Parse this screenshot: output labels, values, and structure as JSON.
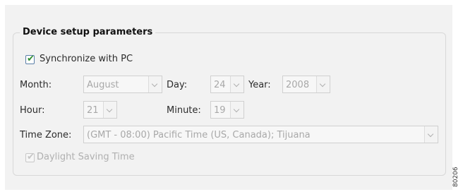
{
  "section": {
    "title": "Device setup parameters"
  },
  "sync": {
    "label": "Synchronize with PC",
    "checked": true
  },
  "month": {
    "label": "Month:",
    "value": "August"
  },
  "day": {
    "label": "Day:",
    "value": "24"
  },
  "year": {
    "label": "Year:",
    "value": "2008"
  },
  "hour": {
    "label": "Hour:",
    "value": "21"
  },
  "minute": {
    "label": "Minute:",
    "value": "19"
  },
  "timezone": {
    "label": "Time Zone:",
    "value": "(GMT - 08:00) Pacific Time (US, Canada); Tijuana"
  },
  "daylight": {
    "label": "Daylight Saving Time",
    "checked": true,
    "enabled": false
  },
  "figure_code": "80206"
}
